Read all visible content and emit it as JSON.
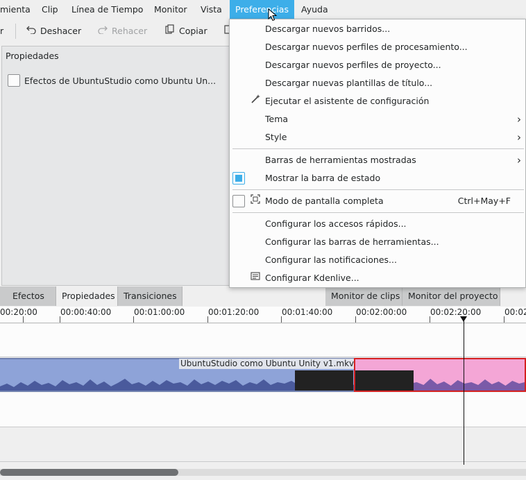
{
  "menubar": {
    "items": [
      "mienta",
      "Clip",
      "Línea de Tiempo",
      "Monitor",
      "Vista",
      "Preferencias",
      "Ayuda"
    ]
  },
  "toolbar": {
    "partial_label": "r",
    "undo_label": "Deshacer",
    "redo_label": "Rehacer",
    "copy_label": "Copiar"
  },
  "properties_panel": {
    "title": "Propiedades",
    "item_label": "Efectos de UbuntuStudio como Ubuntu Un..."
  },
  "dock_tabs": {
    "left": [
      "Efectos",
      "Propiedades",
      "Transiciones"
    ],
    "right": [
      "Monitor de clips",
      "Monitor del proyecto"
    ]
  },
  "timeline": {
    "ruler_labels": [
      "00:20:00",
      "00:00:40:00",
      "00:01:00:00",
      "00:01:20:00",
      "00:01:40:00",
      "00:02:00:00",
      "00:02:20:00",
      "00:02"
    ],
    "clip_name": "UbuntuStudio como Ubuntu Unity v1.mkv"
  },
  "settings_menu": {
    "items": [
      {
        "label": "Descargar nuevos barridos..."
      },
      {
        "label": "Descargar nuevos perfiles de procesamiento..."
      },
      {
        "label": "Descargar nuevos perfiles de proyecto..."
      },
      {
        "label": "Descargar nuevas plantillas de título..."
      },
      {
        "label": "Ejecutar el asistente de configuración",
        "icon": "wand-icon"
      },
      {
        "label": "Tema",
        "submenu": true
      },
      {
        "label": "Style",
        "submenu": true
      },
      {
        "label": "Barras de herramientas mostradas",
        "submenu": true
      },
      {
        "label": "Mostrar la barra de estado",
        "checked": true
      },
      {
        "label": "Modo de pantalla completa",
        "checked": false,
        "icon": "fullscreen-icon",
        "shortcut": "Ctrl+May+F"
      },
      {
        "label": "Configurar los accesos rápidos..."
      },
      {
        "label": "Configurar las barras de herramientas..."
      },
      {
        "label": "Configurar las notificaciones..."
      },
      {
        "label": "Configurar Kdenlive...",
        "icon": "configure-icon"
      }
    ]
  },
  "colors": {
    "accent": "#3daee9",
    "video_clip": "#8ea3d8",
    "audio_clip_selected": "#f4a6d6",
    "selection_border": "#d42020"
  }
}
